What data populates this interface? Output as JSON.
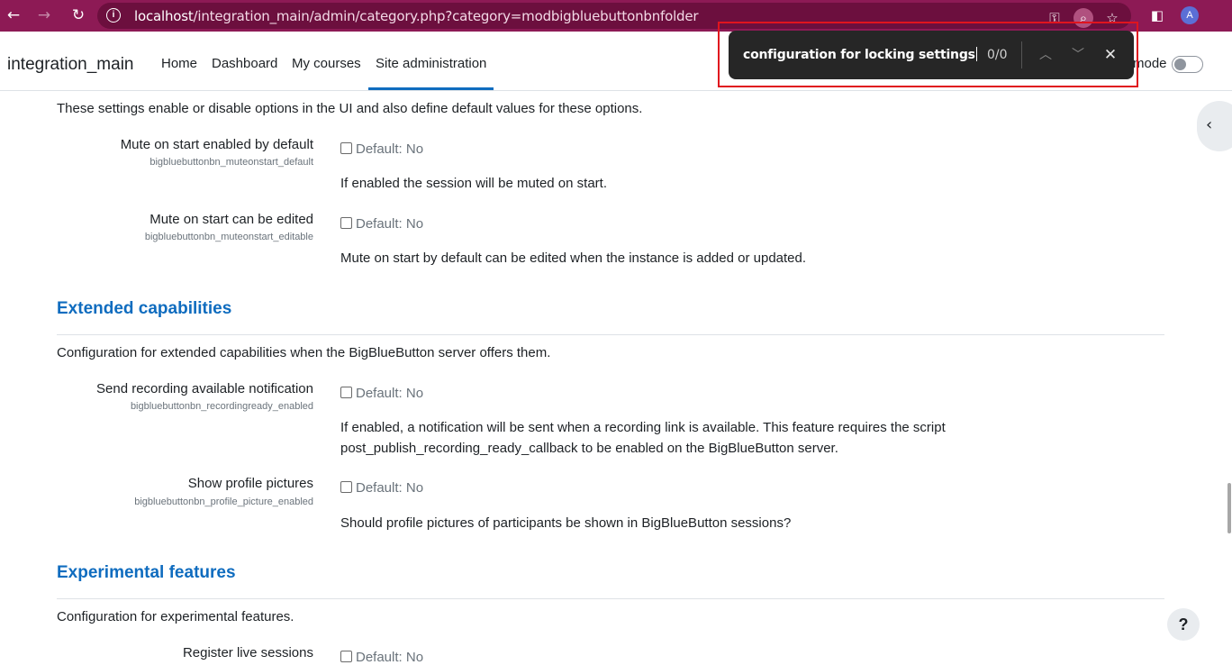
{
  "browser": {
    "back_icon": "←",
    "forward_icon": "→",
    "reload_icon": "↻",
    "url_host": "localhost",
    "url_path": "/integration_main/admin/category.php?category=modbigbluebuttonbnfolder",
    "icons": [
      "key-icon",
      "find-in-page-icon",
      "star-icon",
      "side-panel-icon",
      "avatar"
    ],
    "avatar_letter": "A"
  },
  "navbar": {
    "site_name": "integration_main",
    "links": [
      "Home",
      "Dashboard",
      "My courses",
      "Site administration"
    ],
    "active_link": "Site administration",
    "edit_mode_label": "mode"
  },
  "find_bar": {
    "query": "configuration for locking settings",
    "count": "0/0",
    "prev_icon": "︿",
    "next_icon": "﹀",
    "close_icon": "✕"
  },
  "content": {
    "top_intro": "These settings enable or disable options in the UI and also define default values for these options.",
    "settings_top": [
      {
        "label": "Mute on start enabled by default",
        "key": "bigbluebuttonbn_muteonstart_default",
        "default": "Default: No",
        "description": "If enabled the session will be muted on start."
      },
      {
        "label": "Mute on start can be edited",
        "key": "bigbluebuttonbn_muteonstart_editable",
        "default": "Default: No",
        "description": "Mute on start by default can be edited when the instance is added or updated."
      }
    ],
    "extended": {
      "title": "Extended capabilities",
      "intro": "Configuration for extended capabilities when the BigBlueButton server offers them.",
      "settings": [
        {
          "label": "Send recording available notification",
          "key": "bigbluebuttonbn_recordingready_enabled",
          "default": "Default: No",
          "description_line1": "If enabled, a notification will be sent when a recording link is available. This feature requires the script",
          "description_line2": "post_publish_recording_ready_callback to be enabled on the BigBlueButton server."
        },
        {
          "label": "Show profile pictures",
          "key": "bigbluebuttonbn_profile_picture_enabled",
          "default": "Default: No",
          "description": "Should profile pictures of participants be shown in BigBlueButton sessions?"
        }
      ]
    },
    "experimental": {
      "title": "Experimental features",
      "intro": "Configuration for experimental features.",
      "settings": [
        {
          "label": "Register live sessions",
          "default": "Default: No"
        }
      ]
    }
  },
  "help_label": "?",
  "colors": {
    "browser_bar": "#8d1a55",
    "link_blue": "#0f6cbf",
    "find_highlight": "#e0141e"
  }
}
